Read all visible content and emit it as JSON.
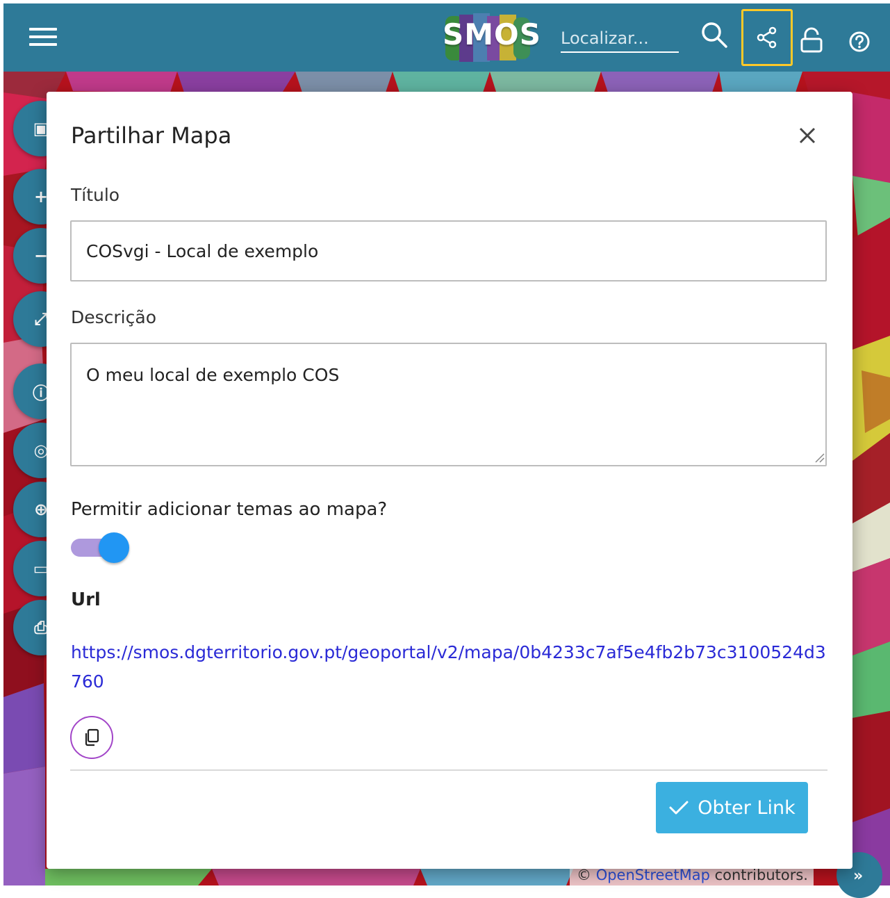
{
  "header": {
    "logo_text": "SMOS",
    "search_placeholder": "Localizar...",
    "icons": [
      "menu-icon",
      "search-icon",
      "share-icon",
      "lock-icon",
      "help-icon"
    ]
  },
  "map": {
    "attribution_prefix": "©",
    "attribution_link": "OpenStreetMap",
    "attribution_suffix": "contributors.",
    "expand_label": "»",
    "tool_icons": [
      "image-icon",
      "zoom-in-icon",
      "zoom-out-icon",
      "fullscreen-icon",
      "info-icon",
      "target-icon",
      "globe-icon",
      "ruler-icon",
      "print-icon"
    ]
  },
  "modal": {
    "title": "Partilhar Mapa",
    "title_label": "Título",
    "title_value": "COSvgi - Local de exemplo",
    "description_label": "Descrição",
    "description_value": "O meu local de exemplo COS",
    "allow_themes_label": "Permitir adicionar temas ao mapa?",
    "allow_themes_enabled": true,
    "url_label": "Url",
    "url_value": "https://smos.dgterritorio.gov.pt/geoportal/v2/mapa/0b4233c7af5e4fb2b73c3100524d3760",
    "get_link_label": "Obter Link"
  },
  "colors": {
    "header": "#2e7a98",
    "highlight": "#ffc928",
    "link": "#2a2ad6",
    "toggle_knob": "#2196f3",
    "toggle_track": "#ae99dd",
    "primary_button": "#3bb0e0",
    "copy_border": "#a245c8"
  }
}
